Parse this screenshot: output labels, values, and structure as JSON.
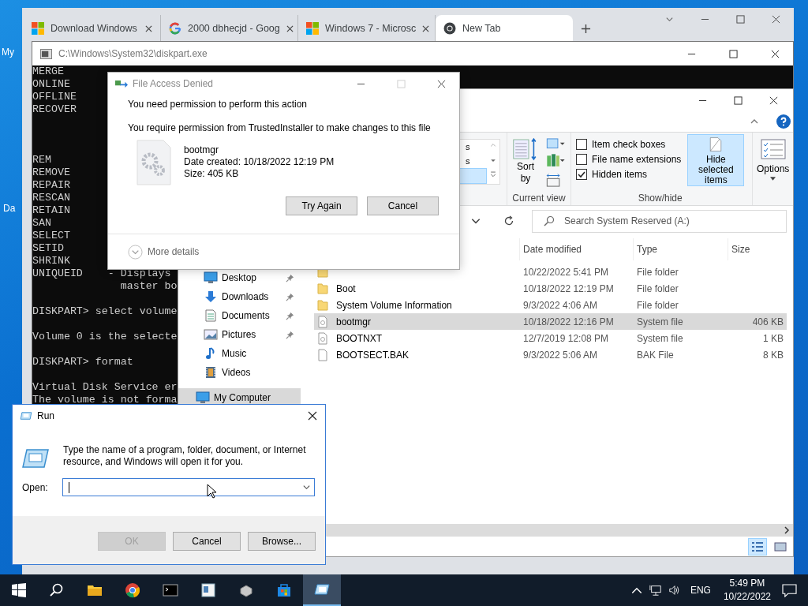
{
  "desktop_icons": [
    {
      "label": "My"
    },
    {
      "label": "Da"
    }
  ],
  "browser": {
    "tabs": [
      {
        "label": "Download Windows",
        "kind": "windows",
        "selected": false
      },
      {
        "label": "2000 dbhecjd - Goog",
        "kind": "google",
        "selected": false
      },
      {
        "label": "Windows 7 - Microsc",
        "kind": "windows",
        "selected": false
      },
      {
        "label": "New Tab",
        "kind": "chrome",
        "selected": true
      }
    ]
  },
  "console": {
    "title": "C:\\Windows\\System32\\diskpart.exe",
    "lines": [
      {
        "kind": "text",
        "text": "MERGE"
      },
      {
        "kind": "text",
        "text": "ONLINE"
      },
      {
        "kind": "text",
        "text": "OFFLINE"
      },
      {
        "kind": "text",
        "text": "RECOVER"
      },
      {
        "kind": "blank"
      },
      {
        "kind": "blank"
      },
      {
        "kind": "blank"
      },
      {
        "kind": "text",
        "text": "REM"
      },
      {
        "kind": "text",
        "text": "REMOVE"
      },
      {
        "kind": "text",
        "text": "REPAIR"
      },
      {
        "kind": "text",
        "text": "RESCAN"
      },
      {
        "kind": "text",
        "text": "RETAIN"
      },
      {
        "kind": "text",
        "text": "SAN"
      },
      {
        "kind": "text",
        "text": "SELECT"
      },
      {
        "kind": "text",
        "text": "SETID"
      },
      {
        "kind": "text",
        "text": "SHRINK"
      },
      {
        "kind": "text",
        "text": "UNIQUEID    - Displays"
      },
      {
        "kind": "text",
        "text": "              master bo"
      },
      {
        "kind": "blank"
      },
      {
        "kind": "text",
        "text": "DISKPART> select volume"
      },
      {
        "kind": "blank"
      },
      {
        "kind": "text",
        "text": "Volume 0 is the selecte"
      },
      {
        "kind": "blank"
      },
      {
        "kind": "text",
        "text": "DISKPART> format"
      },
      {
        "kind": "blank"
      },
      {
        "kind": "text",
        "text": "Virtual Disk Service er"
      },
      {
        "kind": "text",
        "text": "The volume is not forma"
      }
    ]
  },
  "explorer": {
    "layout_options": [
      {
        "label": "s",
        "selected": false
      },
      {
        "label": "s",
        "selected": false
      },
      {
        "selected": true
      }
    ],
    "sort_label": "Sort by",
    "current_view_label": "Current view",
    "checkboxes": [
      {
        "label": "Item check boxes",
        "checked": false
      },
      {
        "label": "File name extensions",
        "checked": false
      },
      {
        "label": "Hidden items",
        "checked": true
      }
    ],
    "hide_selected": {
      "label": "Hide selected items",
      "highlighted": true
    },
    "show_hide_label": "Show/hide",
    "options_label": "Options",
    "search_placeholder": "Search System Reserved (A:)",
    "nav_items": [
      {
        "label": "Desktop",
        "kind": "desktop",
        "pinned": true,
        "selected": false
      },
      {
        "label": "Downloads",
        "kind": "downloads",
        "pinned": true,
        "selected": false
      },
      {
        "label": "Documents",
        "kind": "documents",
        "pinned": true,
        "selected": false
      },
      {
        "label": "Pictures",
        "kind": "pictures",
        "pinned": true,
        "selected": false
      },
      {
        "label": "Music",
        "kind": "music",
        "pinned": false,
        "selected": false
      },
      {
        "label": "Videos",
        "kind": "videos",
        "pinned": false,
        "selected": false
      },
      {
        "label": "My Computer",
        "kind": "pc",
        "pinned": false,
        "selected": true
      }
    ],
    "columns": [
      "Date modified",
      "Type",
      "Size"
    ],
    "rows": [
      {
        "date": "10/22/2022 5:41 PM",
        "type": "File folder",
        "kind": "folder",
        "selected": false
      },
      {
        "name": "Boot",
        "date": "10/18/2022 12:19 PM",
        "type": "File folder",
        "kind": "folder",
        "selected": false
      },
      {
        "name": "System Volume Information",
        "date": "9/3/2022 4:06 AM",
        "type": "File folder",
        "kind": "folder",
        "selected": false
      },
      {
        "name": "bootmgr",
        "date": "10/18/2022 12:16 PM",
        "type": "System file",
        "size": "406 KB",
        "kind": "system",
        "selected": true
      },
      {
        "name": "BOOTNXT",
        "date": "12/7/2019 12:08 PM",
        "type": "System file",
        "size": "1 KB",
        "kind": "system",
        "selected": false
      },
      {
        "name": "BOOTSECT.BAK",
        "date": "9/3/2022 5:06 AM",
        "type": "BAK File",
        "size": "8 KB",
        "kind": "file",
        "selected": false
      }
    ]
  },
  "access_dialog": {
    "title": "File Access Denied",
    "heading": "You need permission to perform this action",
    "message": "You require permission from TrustedInstaller to make changes to this file",
    "file_name": "bootmgr",
    "file_date": "Date created: 10/18/2022 12:19 PM",
    "file_size": "Size: 405 KB",
    "buttons": [
      {
        "label": "Try Again"
      },
      {
        "label": "Cancel"
      }
    ],
    "details": "More details"
  },
  "run_dialog": {
    "title": "Run",
    "description": "Type the name of a program, folder, document, or Internet resource, and Windows will open it for you.",
    "open_label": "Open:",
    "buttons": [
      {
        "label": "OK",
        "disabled": true
      },
      {
        "label": "Cancel",
        "disabled": false
      },
      {
        "label": "Browse...",
        "disabled": false
      }
    ]
  },
  "taskbar": {
    "apps": [
      {
        "kind": "start",
        "active": false
      },
      {
        "kind": "search",
        "active": false
      },
      {
        "kind": "folder",
        "active": false
      },
      {
        "kind": "chrome",
        "active": false
      },
      {
        "kind": "terminal",
        "active": false
      },
      {
        "kind": "document",
        "active": false
      },
      {
        "kind": "drive",
        "active": false
      },
      {
        "kind": "store",
        "active": false
      },
      {
        "kind": "run",
        "active": true
      }
    ],
    "language": "ENG",
    "time": "5:49 PM",
    "date": "10/22/2022"
  }
}
